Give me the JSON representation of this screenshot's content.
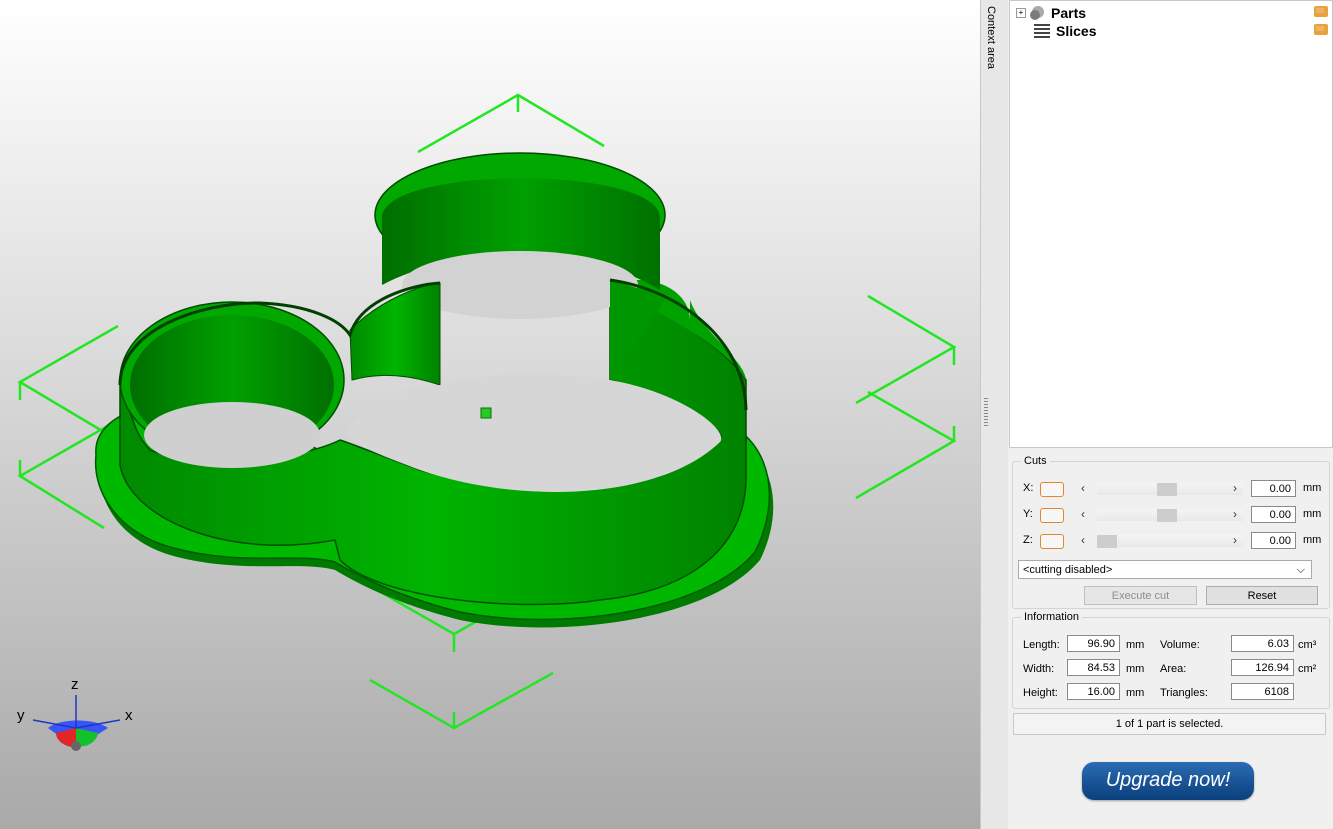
{
  "colors": {
    "model_green": "#00a000",
    "model_green_dark": "#006b00",
    "bbox_green": "#22e622",
    "upgrade_blue": "#0a3f7c"
  },
  "viewport": {
    "axis": {
      "z": "z",
      "y": "y",
      "x": "x"
    }
  },
  "context": {
    "label": "Context area"
  },
  "tree": {
    "items": [
      {
        "label": "Parts",
        "icon": "parts-icon",
        "expandable": true
      },
      {
        "label": "Slices",
        "icon": "slices-icon",
        "expandable": false
      }
    ]
  },
  "cuts": {
    "title": "Cuts",
    "rows": [
      {
        "axis": "X:",
        "value": "0.00",
        "unit": "mm",
        "slider_position": 0.5
      },
      {
        "axis": "Y:",
        "value": "0.00",
        "unit": "mm",
        "slider_position": 0.5
      },
      {
        "axis": "Z:",
        "value": "0.00",
        "unit": "mm",
        "slider_position": 0.0
      }
    ],
    "mode_select": "<cutting disabled>",
    "execute_label": "Execute cut",
    "reset_label": "Reset"
  },
  "information": {
    "title": "Information",
    "length_label": "Length:",
    "length_value": "96.90",
    "length_unit": "mm",
    "width_label": "Width:",
    "width_value": "84.53",
    "width_unit": "mm",
    "height_label": "Height:",
    "height_value": "16.00",
    "height_unit": "mm",
    "volume_label": "Volume:",
    "volume_value": "6.03",
    "volume_unit": "cm³",
    "area_label": "Area:",
    "area_value": "126.94",
    "area_unit": "cm²",
    "triangles_label": "Triangles:",
    "triangles_value": "6108"
  },
  "status": "1 of 1 part is selected.",
  "upgrade_label": "Upgrade now!"
}
